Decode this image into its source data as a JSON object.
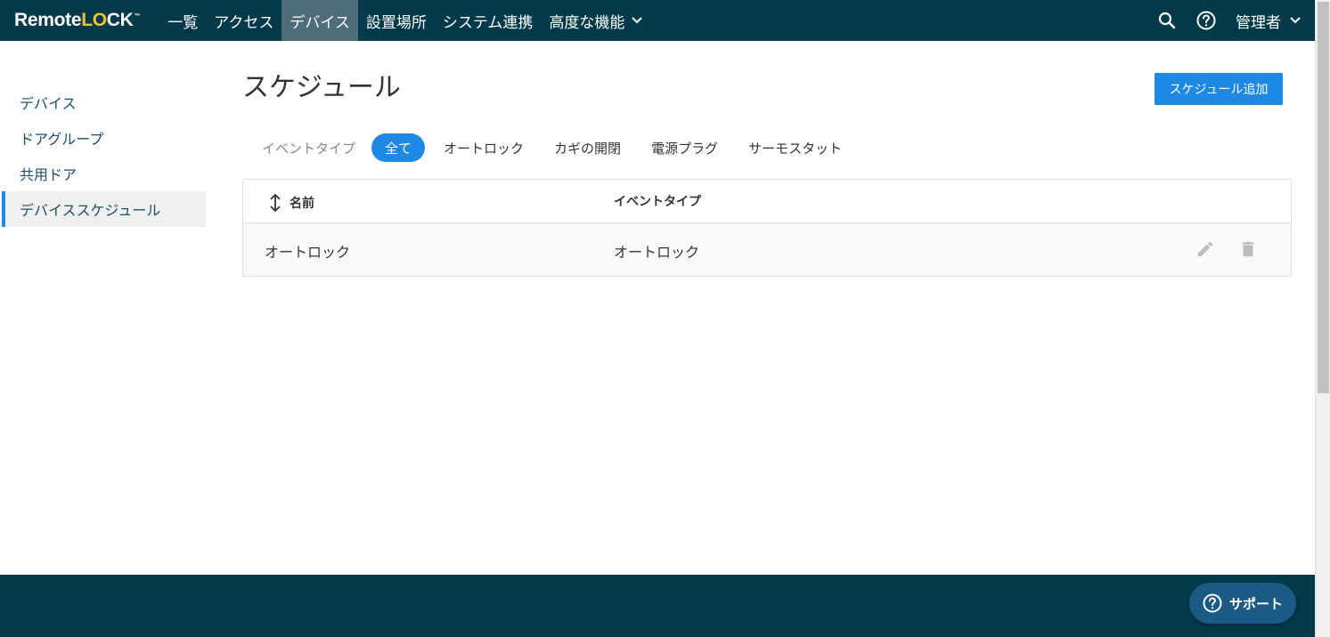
{
  "brand": {
    "name_start": "Remote",
    "name_accent_l": "L",
    "name_accent_o": "O",
    "name_end": "CK",
    "trademark": "™",
    "accent_color": "#f2c230"
  },
  "nav": {
    "items": [
      {
        "label": "一覧"
      },
      {
        "label": "アクセス"
      },
      {
        "label": "デバイス",
        "active": true
      },
      {
        "label": "設置場所"
      },
      {
        "label": "システム連携"
      },
      {
        "label": "高度な機能"
      }
    ],
    "user_label": "管理者",
    "icons": [
      "search-icon",
      "help-icon",
      "chevron-down-icon"
    ]
  },
  "sidebar": {
    "items": [
      {
        "label": "デバイス"
      },
      {
        "label": "ドアグループ"
      },
      {
        "label": "共用ドア"
      },
      {
        "label": "デバイススケジュール",
        "active": true
      }
    ]
  },
  "main": {
    "title": "スケジュール",
    "add_button": "スケジュール追加",
    "filter_label": "イベントタイプ",
    "filters": [
      {
        "label": "全て",
        "active": true
      },
      {
        "label": "オートロック"
      },
      {
        "label": "カギの開閉"
      },
      {
        "label": "電源プラグ"
      },
      {
        "label": "サーモスタット"
      }
    ],
    "table": {
      "columns": [
        "名前",
        "イベントタイプ"
      ],
      "rows": [
        {
          "name": "オートロック",
          "event_type": "オートロック"
        }
      ]
    }
  },
  "footer": {
    "support_label": "サポート"
  },
  "colors": {
    "nav_bg": "#023a4a",
    "nav_active": "#4f6d78",
    "primary": "#1e88e5",
    "support_bg": "#1b5a84"
  }
}
